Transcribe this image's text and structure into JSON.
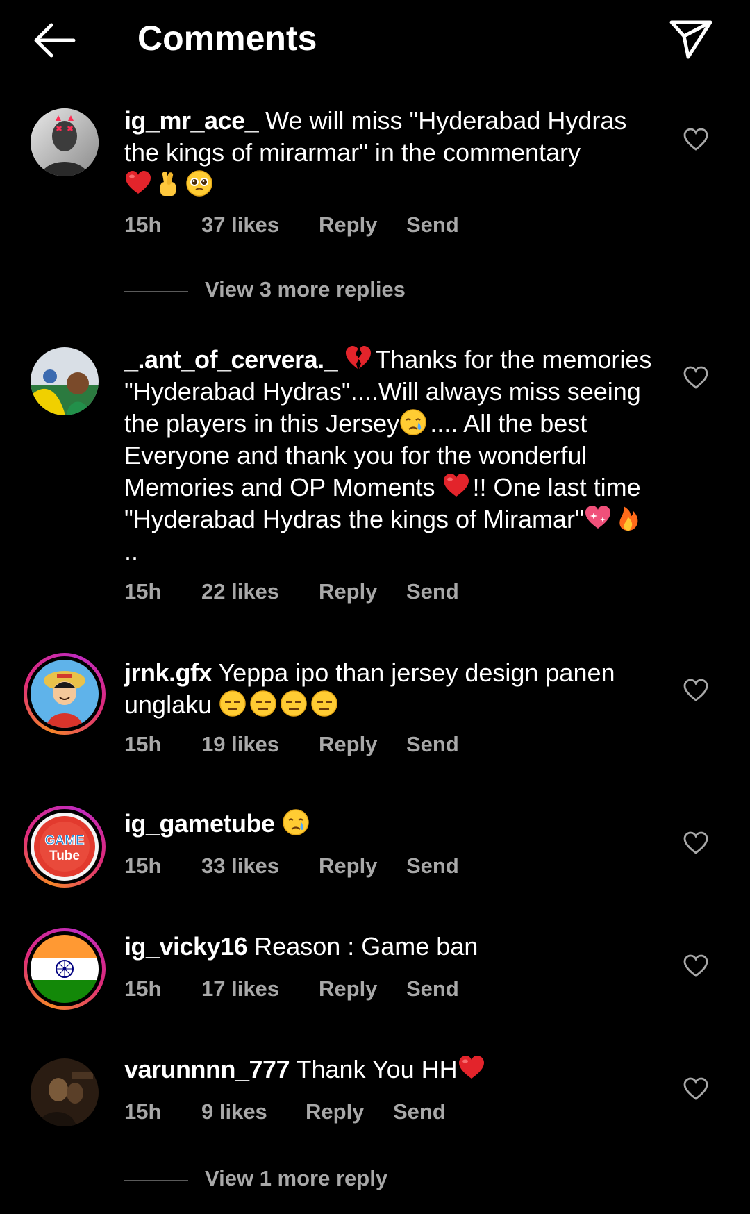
{
  "header": {
    "title": "Comments",
    "back_icon": "arrow-left-icon",
    "share_icon": "paper-plane-icon"
  },
  "comments": [
    {
      "username": "ig_mr_ace_",
      "text": "We will miss \"Hyderabad Hydras the kings of mirarmar\" in the commentary",
      "emojis": [
        "red-heart",
        "crossed-fingers",
        "pleading-face"
      ],
      "time": "15h",
      "likes": "37 likes",
      "reply": "Reply",
      "send": "Send",
      "view_more": "View 3 more replies"
    },
    {
      "username": "_.ant_of_cervera._",
      "text_line_1_emoji": "broken-heart",
      "text_1": "Thanks for the memories \"Hyderabad Hydras\"....Will always miss seeing the players in this Jersey",
      "emoji_2": "crying-face",
      "text_2": ".... All the best Everyone and thank you for the wonderful Memories and OP Moments",
      "emoji_3": "red-heart",
      "text_3": "!! One last time \"Hyderabad Hydras the kings of Miramar\"",
      "emoji_4": "sparkling-heart",
      "emoji_5": "fire",
      "text_4": " ..",
      "time": "15h",
      "likes": "22 likes",
      "reply": "Reply",
      "send": "Send"
    },
    {
      "username": "jrnk.gfx",
      "text": "Yeppa ipo than jersey design panen unglaku",
      "emojis": [
        "expressionless-face",
        "expressionless-face",
        "expressionless-face",
        "expressionless-face"
      ],
      "time": "15h",
      "likes": "19 likes",
      "reply": "Reply",
      "send": "Send"
    },
    {
      "username": "ig_gametube",
      "text": "",
      "emojis": [
        "crying-face"
      ],
      "time": "15h",
      "likes": "33 likes",
      "reply": "Reply",
      "send": "Send",
      "avatar_text_1": "GAME",
      "avatar_text_2": "Tube"
    },
    {
      "username": "ig_vicky16",
      "text": "Reason : Game ban",
      "time": "15h",
      "likes": "17 likes",
      "reply": "Reply",
      "send": "Send"
    },
    {
      "username": "varunnnn_777",
      "text": "Thank You HH",
      "emojis": [
        "red-heart"
      ],
      "time": "15h",
      "likes": "9 likes",
      "reply": "Reply",
      "send": "Send",
      "view_more": "View 1 more reply"
    }
  ],
  "colors": {
    "background": "#000000",
    "text": "#ffffff",
    "secondary_text": "#a8a8a8",
    "story_ring_start": "#f58529",
    "story_ring_end": "#c02bbf"
  }
}
